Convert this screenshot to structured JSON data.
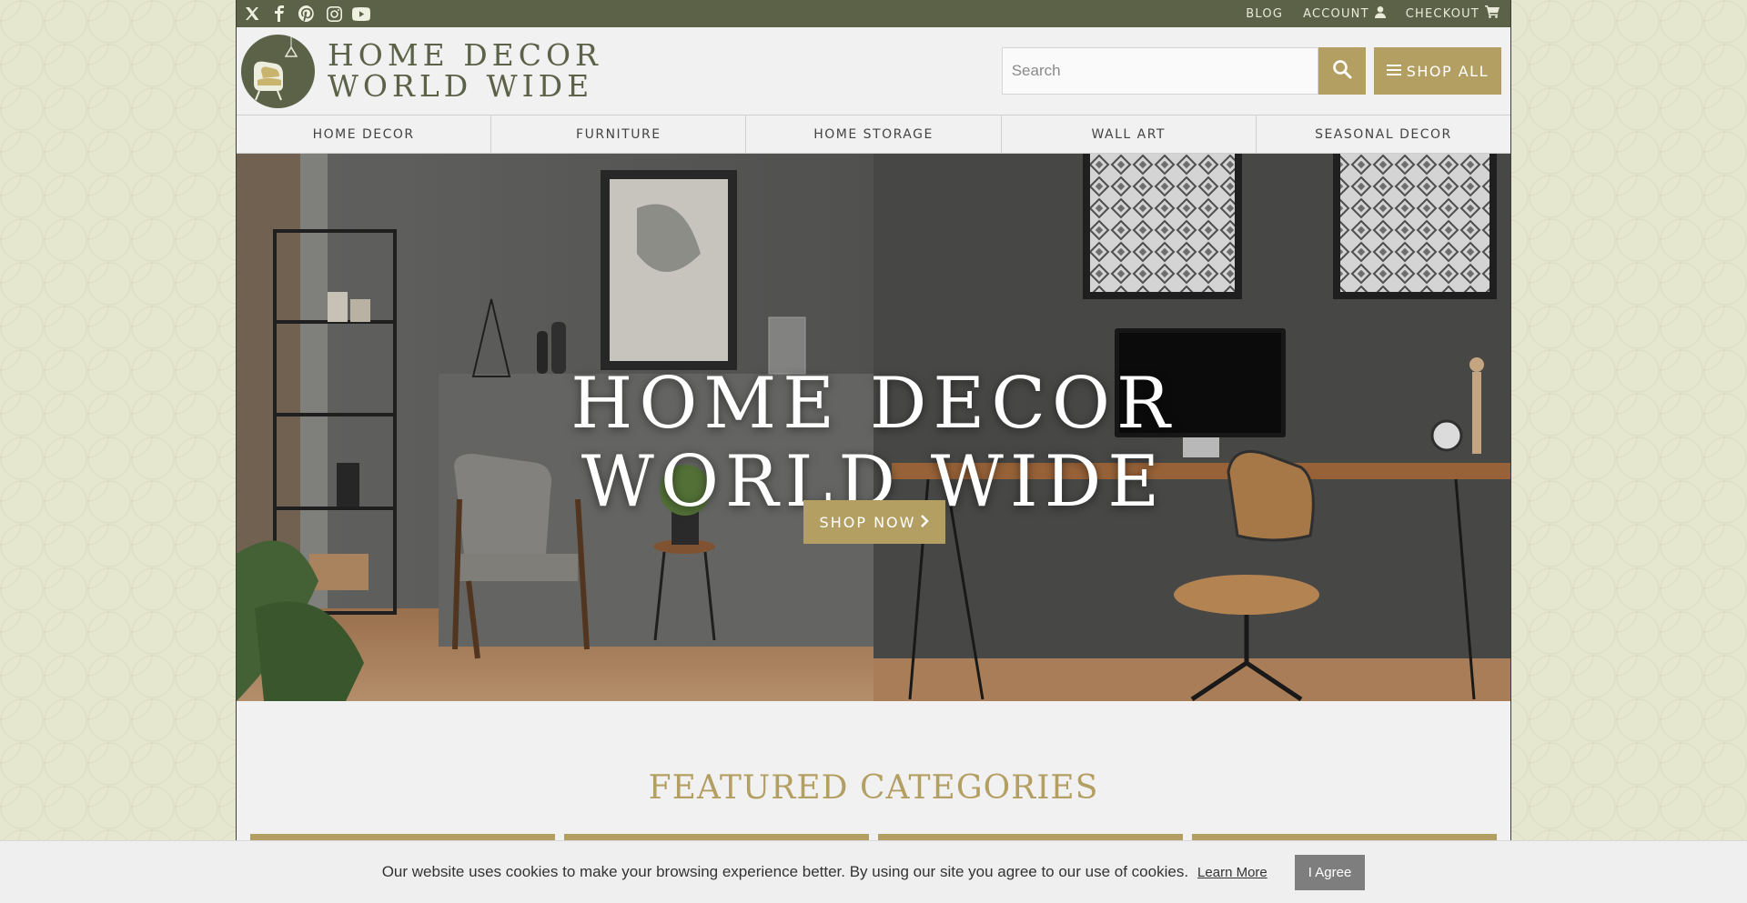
{
  "topbar": {
    "social": [
      "x-icon",
      "facebook-icon",
      "pinterest-icon",
      "instagram-icon",
      "youtube-icon"
    ],
    "links": [
      {
        "label": "BLOG",
        "icon": null
      },
      {
        "label": "ACCOUNT",
        "icon": "user-icon"
      },
      {
        "label": "CHECKOUT",
        "icon": "cart-icon"
      }
    ]
  },
  "header": {
    "logo_line1": "HOME DECOR",
    "logo_line2": "WORLD WIDE",
    "search_placeholder": "Search",
    "shop_all_label": "SHOP ALL"
  },
  "nav": {
    "items": [
      "HOME DECOR",
      "FURNITURE",
      "HOME STORAGE",
      "WALL ART",
      "SEASONAL DECOR"
    ]
  },
  "hero": {
    "title_line1": "HOME DECOR",
    "title_line2": "WORLD WIDE",
    "button_label": "SHOP NOW"
  },
  "featured": {
    "title": "FEATURED CATEGORIES"
  },
  "cookie": {
    "message": "Our website uses cookies to make your browsing experience better. By using our site you agree to our use of cookies.",
    "learn_more": "Learn More",
    "agree": "I Agree"
  },
  "colors": {
    "olive": "#5c6247",
    "gold": "#b49f63",
    "background": "#e6e7cf"
  }
}
